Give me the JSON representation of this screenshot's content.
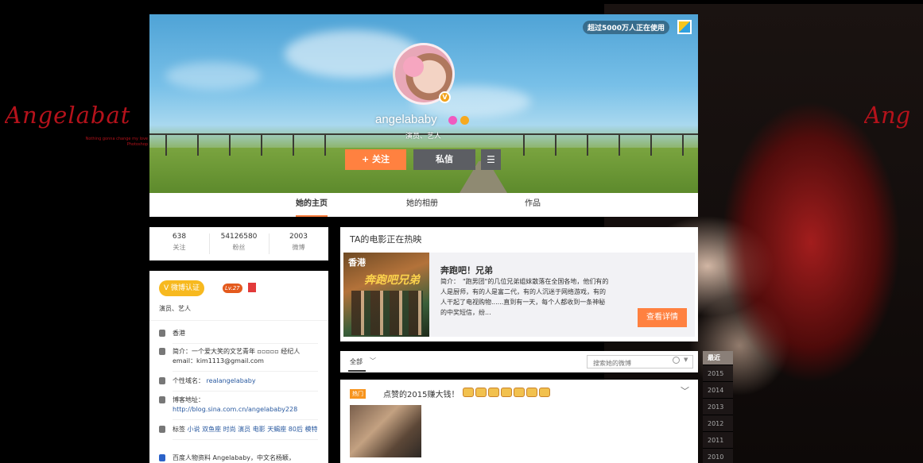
{
  "background": {
    "title": "Angelabat",
    "subtitle_line1": "Nothing gonna change my love",
    "subtitle_line2": "Photoshop",
    "title_right": "Ang"
  },
  "cover": {
    "users_badge": "超过5000万人正在使用",
    "username": "angelababy",
    "occupation": "演员、艺人",
    "follow_label": "+ 关注",
    "message_label": "私信",
    "avatar_verified_glyph": "V"
  },
  "tabs": [
    {
      "label": "她的主页",
      "active": true
    },
    {
      "label": "她的相册",
      "active": false
    },
    {
      "label": "作品",
      "active": false
    }
  ],
  "stats": [
    {
      "num": "638",
      "label": "关注"
    },
    {
      "num": "54126580",
      "label": "粉丝"
    },
    {
      "num": "2003",
      "label": "微博"
    }
  ],
  "profile": {
    "verified_label": "V 微博认证",
    "level": "Lv.27",
    "occupation": "演员、艺人",
    "location": "香港",
    "bio_label": "简介：",
    "bio_text": "一个爱大笑的文艺青年 ▫▫▫▫▫ 经纪人email：kim1113@gmail.com",
    "domain_label": "个性域名：",
    "domain_value": "realangelababy",
    "blog_label": "博客地址：",
    "blog_value": "http://blog.sina.com.cn/angelababy228",
    "tags_label": "标签",
    "tags_value": "小说 双鱼座 时尚 演员 电影 天蝎座 80后 模特",
    "baike": "百度人物资料 Angelababy，中文名杨颖，"
  },
  "movie": {
    "header": "TA的电影正在热映",
    "poster_line1": "香港",
    "poster_line2": "奔跑吧兄弟",
    "title": "奔跑吧！兄弟",
    "desc": "简介：　\"跑男团\"的几位兄弟姐妹散落在全国各地，他们有的人是厨师，有的人是富二代，有的人沉迷于网络游戏，有的人干起了电视购物......直到有一天，每个人都收到一条神秘的中奖短信，纷...",
    "detail_button": "查看详情"
  },
  "filter": {
    "all_label": "全部",
    "search_placeholder": "搜索她的微博"
  },
  "post": {
    "hot_tag": "热门",
    "text": "点赞的2015赚大钱！"
  },
  "timeline": [
    "最近",
    "2015",
    "2014",
    "2013",
    "2012",
    "2011",
    "2010"
  ],
  "colors": {
    "accent": "#ff8140",
    "verified": "#f7b91f",
    "background_red": "#b5121b"
  }
}
